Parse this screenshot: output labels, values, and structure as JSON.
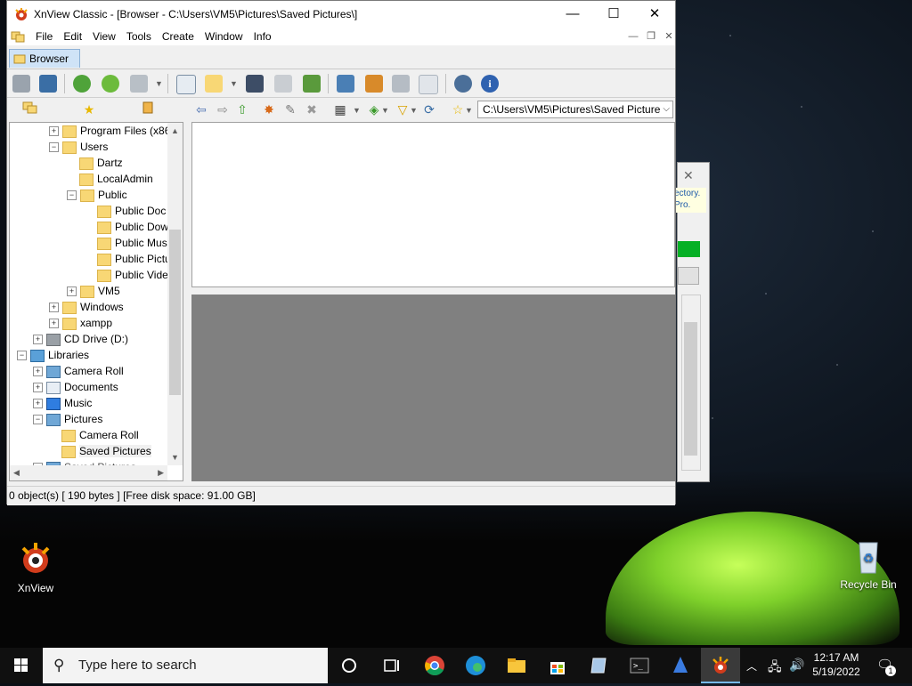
{
  "window": {
    "title": "XnView Classic - [Browser - C:\\Users\\VM5\\Pictures\\Saved Pictures\\]",
    "controls": {
      "minimize": "—",
      "maximize": "☐",
      "close": "✕"
    }
  },
  "menu": [
    "File",
    "Edit",
    "View",
    "Tools",
    "Create",
    "Window",
    "Info"
  ],
  "tab": {
    "label": "Browser"
  },
  "path": {
    "value": "C:\\Users\\VM5\\Pictures\\Saved Picture"
  },
  "tree": [
    {
      "label": "Program Files (x86",
      "expander": "+"
    },
    {
      "label": "Users",
      "expander": "−"
    },
    {
      "label": "Dartz",
      "expander": ""
    },
    {
      "label": "LocalAdmin",
      "expander": ""
    },
    {
      "label": "Public",
      "expander": "−"
    },
    {
      "label": "Public Doc",
      "expander": ""
    },
    {
      "label": "Public Dow",
      "expander": ""
    },
    {
      "label": "Public Mus",
      "expander": ""
    },
    {
      "label": "Public Pictu",
      "expander": ""
    },
    {
      "label": "Public Vide",
      "expander": ""
    },
    {
      "label": "VM5",
      "expander": "+"
    },
    {
      "label": "Windows",
      "expander": "+"
    },
    {
      "label": "xampp",
      "expander": "+"
    },
    {
      "label": "CD Drive (D:)",
      "expander": "+"
    },
    {
      "label": "Libraries",
      "expander": "−"
    },
    {
      "label": "Camera Roll",
      "expander": "+"
    },
    {
      "label": "Documents",
      "expander": "+"
    },
    {
      "label": "Music",
      "expander": "+"
    },
    {
      "label": "Pictures",
      "expander": "−"
    },
    {
      "label": "Camera Roll",
      "expander": ""
    },
    {
      "label": "Saved Pictures",
      "expander": ""
    },
    {
      "label": "Saved Pictures",
      "expander": ""
    }
  ],
  "status": {
    "text": "0 object(s) [ 190 bytes ] [Free disk space: 91.00 GB]"
  },
  "background_dialog": {
    "note": "ectory. Pro."
  },
  "desktop": {
    "icons": [
      {
        "label": "XnView"
      },
      {
        "label": "Recycle Bin"
      }
    ]
  },
  "taskbar": {
    "search_placeholder": "Type here to search",
    "time": "12:17 AM",
    "date": "5/19/2022",
    "notification_count": "1"
  },
  "colors": {
    "folder": "#f8d775",
    "tab": "#cfe3f7",
    "preview": "#808080",
    "taskbar": "#101010"
  }
}
